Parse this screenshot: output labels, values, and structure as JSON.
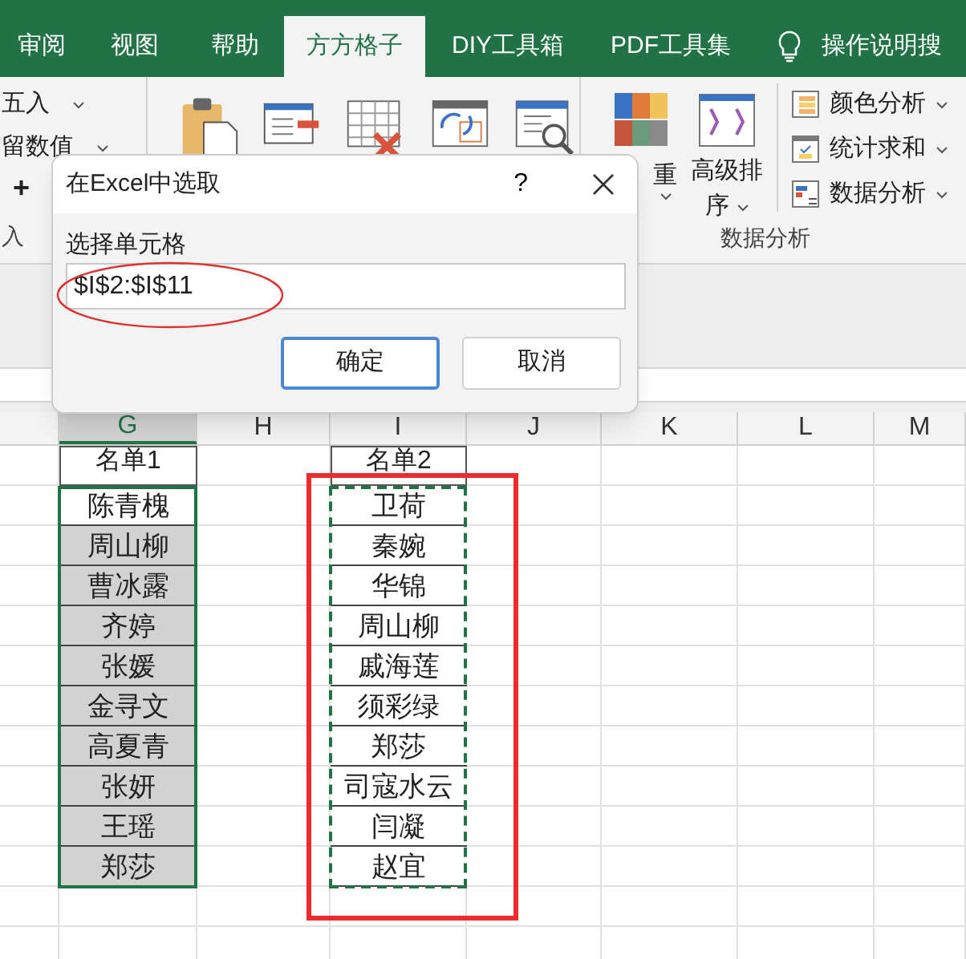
{
  "ribbon": {
    "tabs": [
      {
        "label": "审阅",
        "selected": false
      },
      {
        "label": "视图",
        "selected": false
      },
      {
        "label": "帮助",
        "selected": false
      },
      {
        "label": "方方格子",
        "selected": true
      },
      {
        "label": "DIY工具箱",
        "selected": false
      },
      {
        "label": "PDF工具集",
        "selected": false
      }
    ],
    "search_hint": "操作说明搜",
    "left_group": {
      "items": [
        {
          "label": "五入",
          "dropdown": true
        },
        {
          "label": "留数值",
          "dropdown": true
        }
      ],
      "plus": "+",
      "group_label": "入"
    },
    "data_group": {
      "big_buttons": [
        {
          "label": "重",
          "dropdown": true
        },
        {
          "label": "高级排序",
          "dropdown": true
        }
      ],
      "menu_items": [
        {
          "label": "颜色分析"
        },
        {
          "label": "统计求和"
        },
        {
          "label": "数据分析"
        }
      ],
      "group_label": "数据分析"
    }
  },
  "dialog": {
    "title": "在Excel中选取",
    "help": "?",
    "field_label": "选择单元格",
    "value": "$I$2:$I$11",
    "buttons": [
      {
        "label": "确定",
        "default": true
      },
      {
        "label": "取消",
        "default": false
      }
    ]
  },
  "sheet": {
    "columns": [
      {
        "label": "G",
        "selected": true
      },
      {
        "label": "H",
        "selected": false
      },
      {
        "label": "I",
        "selected": false
      },
      {
        "label": "J",
        "selected": false
      },
      {
        "label": "K",
        "selected": false
      },
      {
        "label": "L",
        "selected": false
      },
      {
        "label": "M",
        "selected": false
      }
    ],
    "list_1": {
      "header": "名单1",
      "cells": [
        {
          "text": "陈青槐",
          "active": true
        },
        {
          "text": "周山柳",
          "active": false
        },
        {
          "text": "曹冰露",
          "active": false
        },
        {
          "text": "齐婷",
          "active": false
        },
        {
          "text": "张媛",
          "active": false
        },
        {
          "text": "金寻文",
          "active": false
        },
        {
          "text": "高夏青",
          "active": false
        },
        {
          "text": "张妍",
          "active": false
        },
        {
          "text": "王瑶",
          "active": false
        },
        {
          "text": "郑莎",
          "active": false
        }
      ]
    },
    "list_2": {
      "header": "名单2",
      "copied": true,
      "cells": [
        "卫荷",
        "秦婉",
        "华锦",
        "周山柳",
        "戚海莲",
        "须彩绿",
        "郑莎",
        "司寇水云",
        "闫凝",
        "赵宜"
      ]
    }
  }
}
